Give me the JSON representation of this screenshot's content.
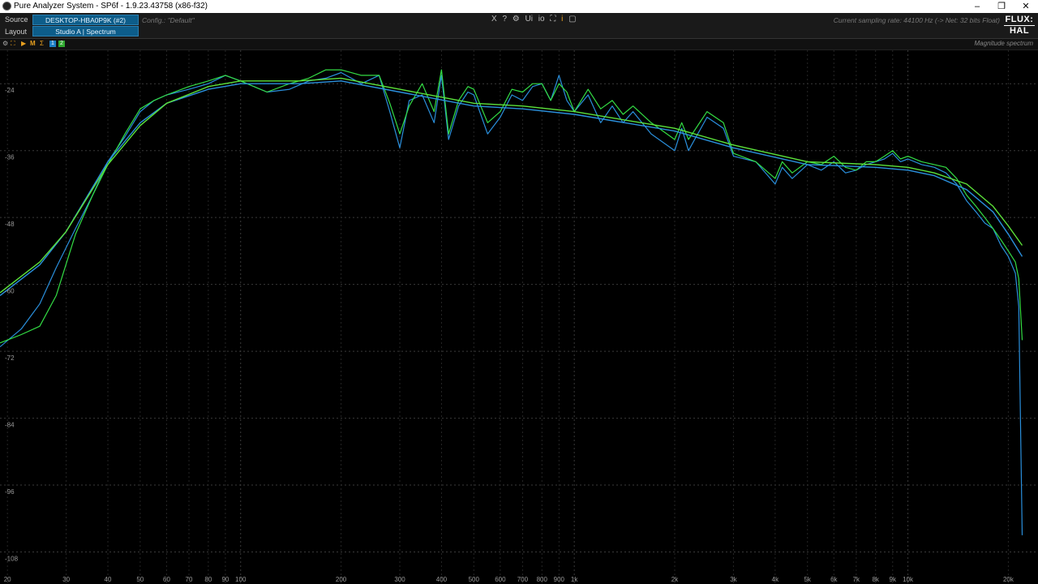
{
  "window": {
    "title": "Pure Analyzer System - SP6f - 1.9.23.43758 (x86-f32)",
    "minimize_glyph": "–",
    "restore_glyph": "❐",
    "close_glyph": "✕"
  },
  "header": {
    "source_label": "Source",
    "source_value": "DESKTOP-HBA0P9K (#2)",
    "layout_label": "Layout",
    "layout_value": "Studio A | Spectrum",
    "config": "Config.: \"Default\"",
    "sampling": "Current sampling rate: 44100 Hz (-> Net: 32 bits Float)",
    "logo_top": "FLUX:",
    "logo_bottom": "HAL",
    "tools": [
      {
        "icon": "close-icon",
        "glyph": "X"
      },
      {
        "icon": "help-icon",
        "glyph": "?"
      },
      {
        "icon": "settings-icon",
        "glyph": "⚙"
      },
      {
        "icon": "ui-icon",
        "glyph": "Ui"
      },
      {
        "icon": "io-icon",
        "glyph": "io"
      },
      {
        "icon": "fullscreen-icon",
        "glyph": "⛶"
      },
      {
        "icon": "info-icon",
        "glyph": "i"
      },
      {
        "icon": "window-icon",
        "glyph": "▢"
      }
    ]
  },
  "toolbar": {
    "view_title": "Magnitude spectrum",
    "chip1": "1",
    "chip2": "2",
    "icons": [
      "settings-icon",
      "fullscreen-icon",
      "play-icon",
      "marker-icon",
      "sum-icon"
    ]
  },
  "colors": {
    "trace1": "#2a8fdc",
    "trace2": "#33dd44",
    "smooth1": "#2a8fdc",
    "smooth2": "#5ce23a",
    "accent": "#e8a020",
    "grid_major": "#3a3a3a",
    "grid_minor": "#262626"
  },
  "chart_data": {
    "type": "line",
    "title": "Magnitude spectrum",
    "xscale": "log",
    "xlim": [
      19,
      24000
    ],
    "ylim": [
      -112,
      -18
    ],
    "x_ticks": [
      {
        "v": 20,
        "label": "20"
      },
      {
        "v": 30,
        "label": "30"
      },
      {
        "v": 40,
        "label": "40"
      },
      {
        "v": 50,
        "label": "50"
      },
      {
        "v": 60,
        "label": "60"
      },
      {
        "v": 70,
        "label": "70"
      },
      {
        "v": 80,
        "label": "80"
      },
      {
        "v": 90,
        "label": "90"
      },
      {
        "v": 100,
        "label": "100"
      },
      {
        "v": 200,
        "label": "200"
      },
      {
        "v": 300,
        "label": "300"
      },
      {
        "v": 400,
        "label": "400"
      },
      {
        "v": 500,
        "label": "500"
      },
      {
        "v": 600,
        "label": "600"
      },
      {
        "v": 700,
        "label": "700"
      },
      {
        "v": 800,
        "label": "800"
      },
      {
        "v": 900,
        "label": "900"
      },
      {
        "v": 1000,
        "label": "1k"
      },
      {
        "v": 2000,
        "label": "2k"
      },
      {
        "v": 3000,
        "label": "3k"
      },
      {
        "v": 4000,
        "label": "4k"
      },
      {
        "v": 5000,
        "label": "5k"
      },
      {
        "v": 6000,
        "label": "6k"
      },
      {
        "v": 7000,
        "label": "7k"
      },
      {
        "v": 8000,
        "label": "8k"
      },
      {
        "v": 9000,
        "label": "9k"
      },
      {
        "v": 10000,
        "label": "10k"
      },
      {
        "v": 20000,
        "label": "20k"
      }
    ],
    "y_ticks": [
      {
        "v": -24,
        "label": "-24"
      },
      {
        "v": -36,
        "label": "-36"
      },
      {
        "v": -48,
        "label": "-48"
      },
      {
        "v": -60,
        "label": "-60"
      },
      {
        "v": -72,
        "label": "-72"
      },
      {
        "v": -84,
        "label": "-84"
      },
      {
        "v": -96,
        "label": "-96"
      },
      {
        "v": -108,
        "label": "-108"
      }
    ],
    "series": [
      {
        "x": [
          19,
          22,
          25,
          28,
          32,
          36,
          40,
          45,
          50,
          55,
          60,
          70,
          80,
          90,
          100,
          120,
          140,
          160,
          180,
          200,
          230,
          260,
          280,
          300,
          320,
          350,
          380,
          400,
          420,
          450,
          480,
          500,
          550,
          600,
          650,
          700,
          750,
          800,
          850,
          900,
          950,
          1000,
          1100,
          1200,
          1300,
          1400,
          1500,
          1700,
          2000,
          2100,
          2200,
          2500,
          2800,
          3000,
          3500,
          4000,
          4200,
          4500,
          5000,
          5500,
          6000,
          6500,
          7000,
          7500,
          8000,
          8500,
          9000,
          9500,
          10000,
          11000,
          12000,
          13000,
          14000,
          15000,
          16000,
          17000,
          18000,
          19000,
          20000,
          21000,
          21500,
          22000
        ],
        "y": [
          -71.2,
          -68,
          -63.5,
          -57,
          -50,
          -44,
          -38,
          -33.5,
          -29,
          -27,
          -26,
          -25,
          -24,
          -22.5,
          -23.5,
          -25.5,
          -25,
          -23.5,
          -23,
          -22,
          -24,
          -22.5,
          -29,
          -35.5,
          -27,
          -26,
          -31,
          -22.5,
          -34,
          -28,
          -25.5,
          -26,
          -33,
          -30,
          -26,
          -27,
          -24.5,
          -24,
          -27,
          -22.5,
          -27,
          -29,
          -26,
          -31,
          -28,
          -31,
          -29,
          -33,
          -36,
          -32,
          -36,
          -30,
          -32,
          -37,
          -38,
          -42,
          -39,
          -41,
          -38.5,
          -39.5,
          -38,
          -40,
          -39.5,
          -38.5,
          -38,
          -37.5,
          -36.5,
          -38,
          -37.5,
          -38.5,
          -39,
          -40,
          -42,
          -45,
          -47,
          -49,
          -50,
          -53,
          -55,
          -58,
          -64,
          -105
        ]
      },
      {
        "x": [
          19,
          22,
          25,
          28,
          32,
          36,
          40,
          45,
          50,
          55,
          60,
          70,
          80,
          90,
          100,
          120,
          140,
          160,
          180,
          200,
          230,
          260,
          280,
          300,
          320,
          350,
          380,
          400,
          420,
          450,
          480,
          500,
          550,
          600,
          650,
          700,
          750,
          800,
          850,
          900,
          950,
          1000,
          1100,
          1200,
          1300,
          1400,
          1500,
          1700,
          2000,
          2100,
          2200,
          2500,
          2800,
          3000,
          3500,
          4000,
          4200,
          4500,
          5000,
          5500,
          6000,
          6500,
          7000,
          7500,
          8000,
          8500,
          9000,
          9500,
          10000,
          11000,
          12000,
          13000,
          14000,
          15000,
          16000,
          17000,
          18000,
          19000,
          20000,
          21000,
          21500,
          22000
        ],
        "y": [
          -70.5,
          -69,
          -67.5,
          -62,
          -51,
          -44,
          -38.5,
          -33,
          -28.5,
          -27,
          -26,
          -24.5,
          -23.5,
          -22.5,
          -23.5,
          -25.5,
          -24,
          -23,
          -21.5,
          -21.5,
          -22.5,
          -22.5,
          -27.5,
          -33,
          -28,
          -24,
          -29,
          -21.5,
          -33,
          -27,
          -24.5,
          -25,
          -31,
          -29,
          -25,
          -25.5,
          -24,
          -24,
          -27,
          -24,
          -25.5,
          -29,
          -25,
          -28.5,
          -27,
          -29.5,
          -28,
          -31,
          -34,
          -31,
          -34,
          -29,
          -31,
          -36.5,
          -38,
          -41,
          -38,
          -40,
          -38,
          -38.5,
          -37,
          -39,
          -39.5,
          -38,
          -38,
          -37,
          -36,
          -37.5,
          -37,
          -38,
          -38.5,
          -39,
          -41,
          -44,
          -46,
          -48,
          -50,
          -52,
          -54,
          -56,
          -59,
          -70
        ]
      },
      {
        "x": [
          19,
          25,
          30,
          40,
          50,
          60,
          80,
          100,
          150,
          200,
          300,
          500,
          700,
          1000,
          2000,
          3000,
          5000,
          8000,
          10000,
          12000,
          15000,
          18000,
          20000,
          22000
        ],
        "y": [
          -62,
          -56.5,
          -50.5,
          -38,
          -31,
          -27.5,
          -25,
          -24,
          -24,
          -23.5,
          -25.5,
          -28,
          -28.5,
          -29.5,
          -32.5,
          -35.5,
          -38.5,
          -39,
          -39.5,
          -40.5,
          -43,
          -47,
          -51,
          -55
        ]
      },
      {
        "x": [
          19,
          25,
          30,
          40,
          50,
          60,
          80,
          100,
          150,
          200,
          300,
          500,
          700,
          1000,
          2000,
          3000,
          5000,
          8000,
          10000,
          12000,
          15000,
          18000,
          20000,
          22000
        ],
        "y": [
          -61.5,
          -56,
          -50.5,
          -38.5,
          -31.5,
          -27.5,
          -24.5,
          -23.5,
          -23.5,
          -23,
          -25,
          -27.5,
          -28,
          -29,
          -32,
          -35,
          -38,
          -38.5,
          -39,
          -40,
          -42,
          -46,
          -49.5,
          -53
        ]
      }
    ]
  }
}
